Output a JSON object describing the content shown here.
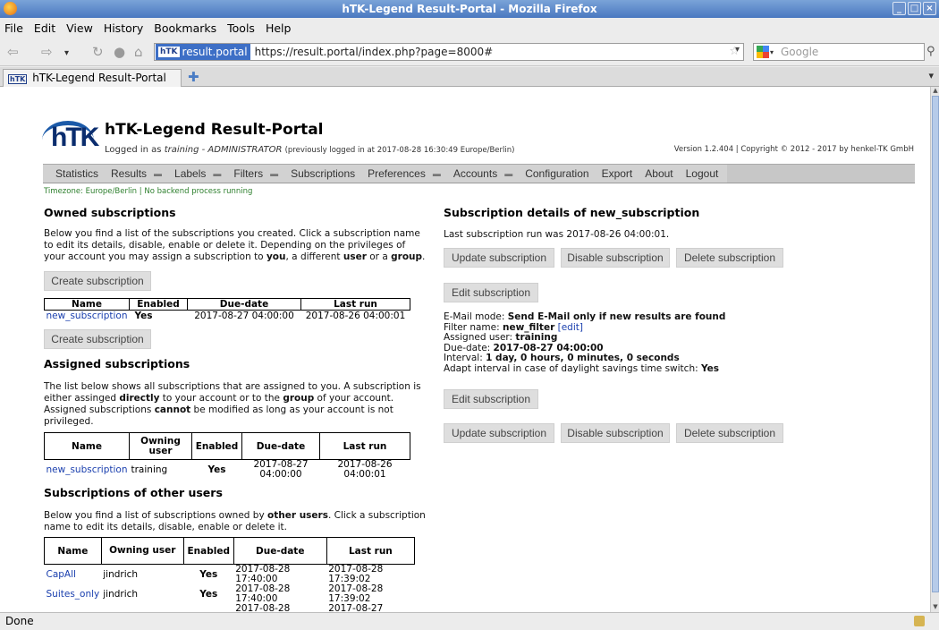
{
  "window": {
    "title": "hTK-Legend Result-Portal - Mozilla Firefox"
  },
  "menu": [
    "File",
    "Edit",
    "View",
    "History",
    "Bookmarks",
    "Tools",
    "Help"
  ],
  "urlbar": {
    "site": "result.portal",
    "url": "https://result.portal/index.php?page=8000#"
  },
  "search": {
    "placeholder": "Google"
  },
  "tab": {
    "title": "hTK-Legend Result-Portal"
  },
  "status": {
    "text": "Done"
  },
  "portal": {
    "logo_text": "hTK",
    "title": "hTK-Legend Result-Portal",
    "logged_prefix": "Logged in as ",
    "user": "training",
    "role": " - ADMINISTRATOR ",
    "previous": "(previously logged in at 2017-08-28 16:30:49 Europe/Berlin)",
    "version": "Version 1.2.404 | Copyright © 2012 - 2017 by henkel-TK GmbH",
    "timezone": "Timezone: Europe/Berlin | No backend process running"
  },
  "nav": [
    {
      "label": "Statistics",
      "dropdown": false
    },
    {
      "label": "Results",
      "dropdown": true
    },
    {
      "label": "Labels",
      "dropdown": true
    },
    {
      "label": "Filters",
      "dropdown": true
    },
    {
      "label": "Subscriptions",
      "dropdown": false
    },
    {
      "label": "Preferences",
      "dropdown": true
    },
    {
      "label": "Accounts",
      "dropdown": true
    },
    {
      "label": "Configuration",
      "dropdown": false
    },
    {
      "label": "Export",
      "dropdown": false
    },
    {
      "label": "About",
      "dropdown": false
    },
    {
      "label": "Logout",
      "dropdown": false
    }
  ],
  "owned": {
    "heading": "Owned subscriptions",
    "p1": "Below you find a list of the subscriptions you created. Click a subscription name",
    "p2": "to edit its details, disable, enable or delete it. Depending on the privileges of",
    "p3a": "your account you may assign a subscription to ",
    "p3b": "you",
    "p3c": ", a different ",
    "p3d": "user",
    "p3e": " or a ",
    "p3f": "group",
    "p3g": ".",
    "create_label": "Create subscription",
    "headers": [
      "Name",
      "Enabled",
      "Due-date",
      "Last run"
    ],
    "rows": [
      {
        "name": "new_subscription",
        "enabled": "Yes",
        "due": "2017-08-27 04:00:00",
        "last": "2017-08-26 04:00:01"
      }
    ]
  },
  "assigned": {
    "heading": "Assigned subscriptions",
    "l1": "The list below shows all subscriptions that are assigned to you. A subscription is",
    "l2a": "either assinged ",
    "l2b": "directly",
    "l2c": " to your account or to the ",
    "l2d": "group",
    "l2e": " of your account.",
    "l3a": "Assigned subscriptions ",
    "l3b": "cannot",
    "l3c": " be modified as long as your account is not",
    "l4": "privileged.",
    "headers": [
      "Name",
      "Owning user",
      "Enabled",
      "Due-date",
      "Last run"
    ],
    "rows": [
      {
        "name": "new_subscription",
        "owner": "training",
        "enabled": "Yes",
        "due1": "2017-08-27",
        "due2": "04:00:00",
        "last1": "2017-08-26",
        "last2": "04:00:01"
      }
    ]
  },
  "others": {
    "heading": "Subscriptions of other users",
    "l1a": "Below you find a list of subscriptions owned by ",
    "l1b": "other users",
    "l1c": ". Click a subscription",
    "l2": "name to edit its details, disable, enable or delete it.",
    "headers": [
      "Name",
      "Owning user",
      "Enabled",
      "Due-date",
      "Last run"
    ],
    "rows": [
      {
        "name": "CapAll",
        "owner": "jindrich",
        "enabled": "Yes",
        "due1": "2017-08-28",
        "due2": "17:40:00",
        "last1": "2017-08-28",
        "last2": "17:39:02"
      },
      {
        "name": "Suites_only",
        "owner": "jindrich",
        "enabled": "Yes",
        "due1": "2017-08-28",
        "due2": "17:40:00",
        "last1": "2017-08-28",
        "last2": "17:39:02"
      },
      {
        "name": "",
        "owner": "",
        "enabled": "",
        "due1": "2017-08-28",
        "due2": "",
        "last1": "2017-08-27",
        "last2": ""
      }
    ]
  },
  "details": {
    "heading": "Subscription details of new_subscription",
    "last_run": "Last subscription run was 2017-08-26 04:00:01.",
    "update": "Update subscription",
    "disable": "Disable subscription",
    "delete": "Delete subscription",
    "edit": "Edit subscription",
    "email_label": "E-Mail mode: ",
    "email_value": "Send E-Mail only if new results are found",
    "filter_label": "Filter name: ",
    "filter_value": "new_filter",
    "filter_edit": "[edit]",
    "user_label": "Assigned user: ",
    "user_value": "training",
    "due_label": "Due-date: ",
    "due_value": "2017-08-27 04:00:00",
    "interval_label": "Interval: ",
    "interval_value": "1 day, 0 hours, 0 minutes, 0 seconds",
    "adapt_label": "Adapt interval in case of daylight savings time switch: ",
    "adapt_value": "Yes"
  }
}
